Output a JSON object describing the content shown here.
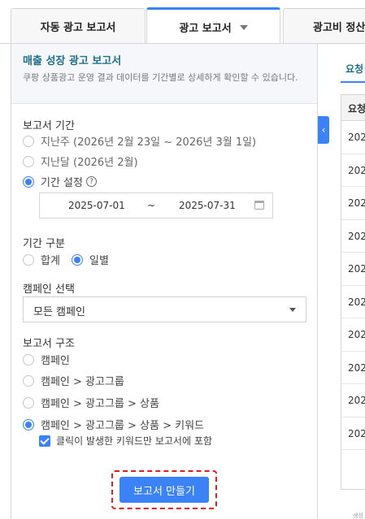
{
  "tabs": {
    "auto_report": "자동 광고 보고서",
    "ad_report": "광고 보고서",
    "ad_settlement": "광고비 정산"
  },
  "panel": {
    "title": "매출 성장 광고 보고서",
    "description": "쿠팡 상품광고 운영 결과 데이터를 기간별로 상세하게 확인할 수 있습니다."
  },
  "report_period": {
    "label": "보고서 기간",
    "last_week": "지난주 (2026년 2월 23일 ~ 2026년 3월 1일)",
    "last_month": "지난달 (2026년 2월)",
    "custom": "기간 설정",
    "help_icon": "?",
    "start_date": "2025-07-01",
    "separator": "~",
    "end_date": "2025-07-31"
  },
  "period_type": {
    "label": "기간 구분",
    "total": "합계",
    "daily": "일별"
  },
  "campaign_select": {
    "label": "캠페인 선택",
    "value": "모든 캠페인"
  },
  "report_structure": {
    "label": "보고서 구조",
    "opt1": "캠페인",
    "opt2": "캠페인 > 광고그룹",
    "opt3": "캠페인 > 광고그룹 > 상품",
    "opt4": "캠페인 > 광고그룹 > 상품 > 키워드",
    "checkbox_label": "클릭이 발생한 키워드만 보고서에 포함"
  },
  "create_button": "보고서 만들기",
  "collapse_icon": "‹",
  "right_panel": {
    "tab": "요청",
    "header": "요청",
    "rows": [
      "202",
      "202",
      "202",
      "202",
      "202",
      "202",
      "202",
      "202",
      "202",
      "202"
    ],
    "footer_text": "생성"
  },
  "colors": {
    "accent": "#3b82f6",
    "title": "#1f6f8b",
    "highlight": "#e11d1d"
  }
}
